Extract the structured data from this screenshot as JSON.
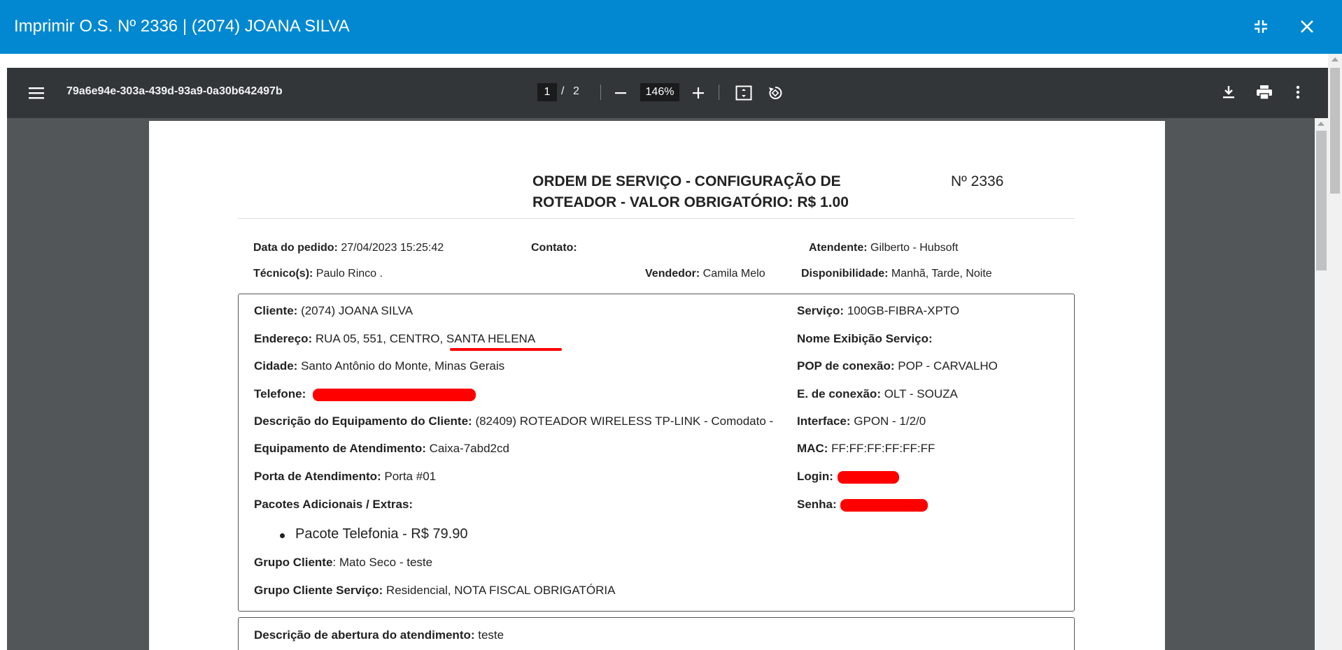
{
  "dialog": {
    "title": "Imprimir O.S. Nº 2336 | (2074) JOANA SILVA",
    "icons": [
      "compress-icon",
      "close-icon"
    ]
  },
  "viewer": {
    "doc_name": "79a6e94e-303a-439d-93a9-0a30b642497b",
    "page_current": "1",
    "page_sep": "/",
    "page_total": "2",
    "zoom": "146%",
    "icons": [
      "menu-icon",
      "zoom-out-icon",
      "zoom-in-icon",
      "fit-page-icon",
      "rotate-icon",
      "download-icon",
      "print-icon",
      "more-icon"
    ]
  },
  "document": {
    "title_line1": "ORDEM DE SERVIÇO - CONFIGURAÇÃO DE",
    "title_line2": "ROTEADOR - VALOR OBRIGATÓRIO: R$ 1.00",
    "number": "Nº 2336",
    "meta": {
      "data_pedido_label": "Data do pedido:",
      "data_pedido_value": " 27/04/2023 15:25:42",
      "contato_label": "Contato:",
      "contato_value": "",
      "atendente_label": "Atendente:",
      "atendente_value": " Gilberto - Hubsoft",
      "tecnico_label": "Técnico(s):",
      "tecnico_value": " Paulo Rinco .",
      "vendedor_label": "Vendedor:",
      "vendedor_value": " Camila Melo",
      "disponibilidade_label": "Disponibilidade:",
      "disponibilidade_value": " Manhã, Tarde, Noite"
    },
    "left_fields": [
      {
        "label": "Cliente:",
        "value": " (2074) JOANA SILVA"
      },
      {
        "label": "Endereço:",
        "value": " RUA 05, 551, CENTRO,  SANTA HELENA"
      },
      {
        "label": "Cidade:",
        "value": " Santo Antônio do Monte, Minas Gerais"
      },
      {
        "label": "Telefone:",
        "value": ""
      },
      {
        "label": "Descrição do Equipamento do Cliente:",
        "value": " (82409) ROTEADOR WIRELESS TP-LINK - Comodato -"
      },
      {
        "label": "Equipamento de Atendimento:",
        "value": " Caixa-7abd2cd"
      },
      {
        "label": "Porta de Atendimento:",
        "value": " Porta #01"
      },
      {
        "label": "Pacotes Adicionais / Extras:",
        "value": ""
      }
    ],
    "right_fields": [
      {
        "label": "Serviço:",
        "value": " 100GB-FIBRA-XPTO"
      },
      {
        "label": "Nome Exibição Serviço:",
        "value": ""
      },
      {
        "label": "POP de conexão:",
        "value": " POP - CARVALHO"
      },
      {
        "label": "E. de conexão:",
        "value": " OLT - SOUZA"
      },
      {
        "label": "Interface:",
        "value": " GPON - 1/2/0"
      },
      {
        "label": "MAC:",
        "value": " FF:FF:FF:FF:FF:FF"
      },
      {
        "label": "Login:",
        "value": ""
      },
      {
        "label": "Senha:",
        "value": ""
      }
    ],
    "pacote_item": "Pacote Telefonia - R$ 79.90",
    "grupo_cliente_label": "Grupo Cliente",
    "grupo_cliente_value": ": Mato Seco - teste",
    "grupo_servico_label": "Grupo Cliente Serviço:",
    "grupo_servico_value": " Residencial, NOTA FISCAL OBRIGATÓRIA",
    "descricao_label": "Descrição de abertura do atendimento:",
    "descricao_value": " teste"
  },
  "colors": {
    "header": "#0288d1",
    "toolbar": "#323639",
    "viewer_bg": "#525659",
    "redaction": "#ff0000"
  }
}
